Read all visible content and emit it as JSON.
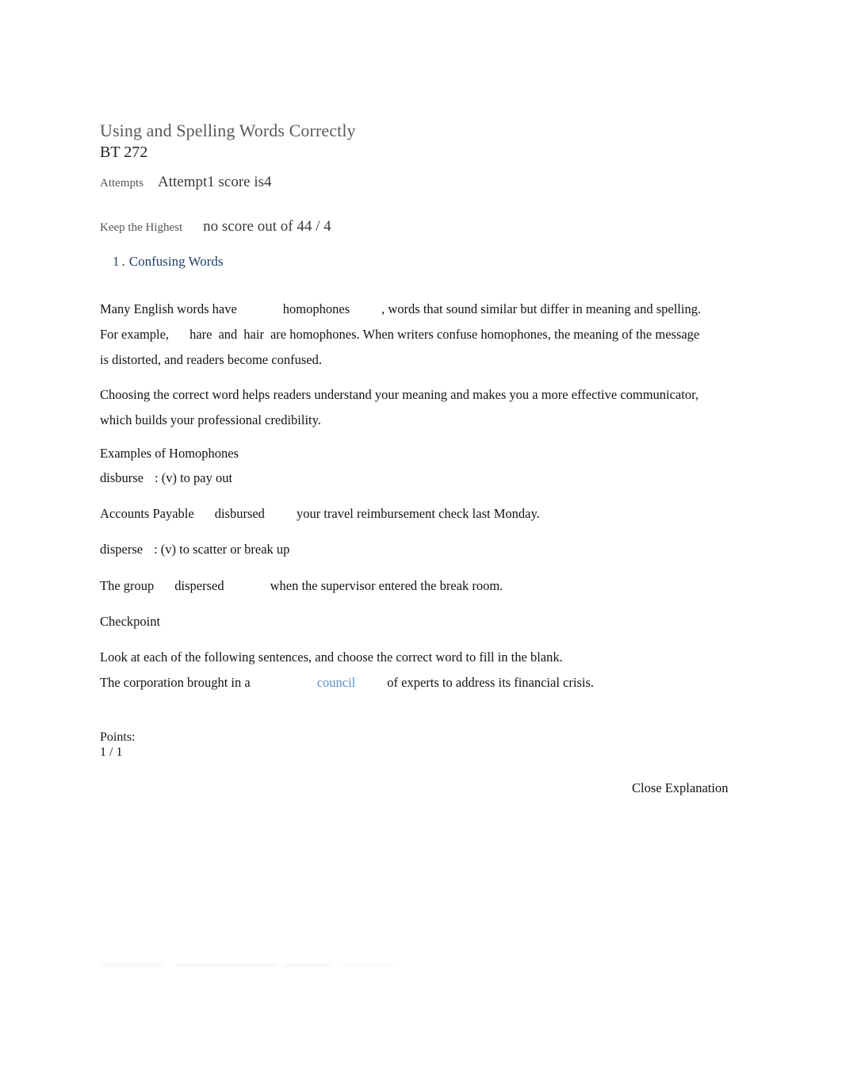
{
  "document": {
    "title": "Using and Spelling Words Correctly",
    "subtitle": "BT 272"
  },
  "meta": {
    "attempts_label": "Attempts",
    "attempts_value": "Attempt1 score is4",
    "keep_label": "Keep the Highest",
    "keep_value": "no score out of 44 / 4"
  },
  "section": {
    "number": "1",
    "separator": ".",
    "heading": "Confusing Words"
  },
  "body": {
    "paragraph1": {
      "part1": "Many English words have",
      "term": "homophones",
      "part2": ", words that sound similar but differ in meaning and spelling.",
      "part3": "For example,",
      "word_a": "hare",
      "conjunction": "and",
      "word_b": "hair",
      "part4": "are homophones. When writers confuse homophones, the meaning of the",
      "part5": "message is distorted, and readers become confused."
    },
    "paragraph2": {
      "line1": "Choosing the correct word helps readers understand your meaning and makes you a more effective",
      "line2": "communicator, which builds your professional credibility."
    },
    "examples_heading": "Examples of Homophones",
    "entries": [
      {
        "term": "disburse",
        "definition": ": (v) to pay out",
        "example_part1": "Accounts Payable",
        "example_term": "disbursed",
        "example_part2": "your travel reimbursement check last Monday."
      },
      {
        "term": "disperse",
        "definition": ": (v) to scatter or break up",
        "example_part1": "The group",
        "example_term": "dispersed",
        "example_part2": "when the supervisor entered the break room."
      }
    ],
    "checkpoint_heading": "Checkpoint",
    "instruction": "Look at each of the following sentences, and choose the correct word to fill in the blank.",
    "question": {
      "part1": "The corporation brought in a",
      "answer": "council",
      "part2": "of experts to address its financial crisis."
    }
  },
  "points": {
    "label": "Points:",
    "value": "1 / 1"
  },
  "actions": {
    "close_explanation": "Close Explanation"
  },
  "colors": {
    "section_heading": "#1f4068",
    "answer_word": "#5a8fc8",
    "title": "#5a5a5a",
    "body_text": "#141414"
  }
}
